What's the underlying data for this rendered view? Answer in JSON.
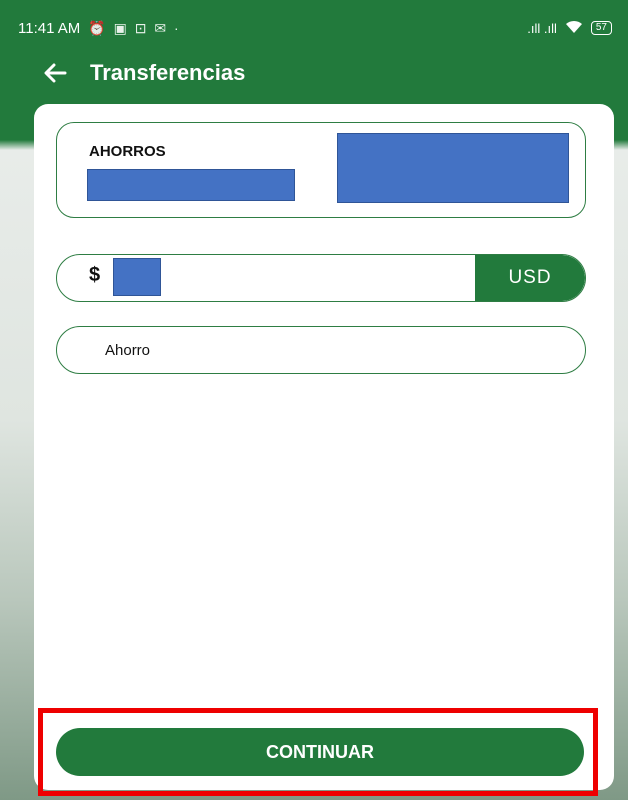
{
  "status_bar": {
    "time": "11:41 AM",
    "left_icons": "⏰ ▣ ⊡ ✉ ·",
    "signal": ".ıll .ıll",
    "battery": "57"
  },
  "app_bar": {
    "title": "Transferencias"
  },
  "account": {
    "type_label": "AHORROS"
  },
  "amount": {
    "currency_symbol": "$",
    "currency_code": "USD"
  },
  "description": {
    "value": "Ahorro"
  },
  "actions": {
    "continue_label": "CONTINUAR"
  },
  "colors": {
    "primary_green": "#227a3c",
    "redaction_blue": "#4472c4",
    "highlight_red": "#ee0000"
  }
}
